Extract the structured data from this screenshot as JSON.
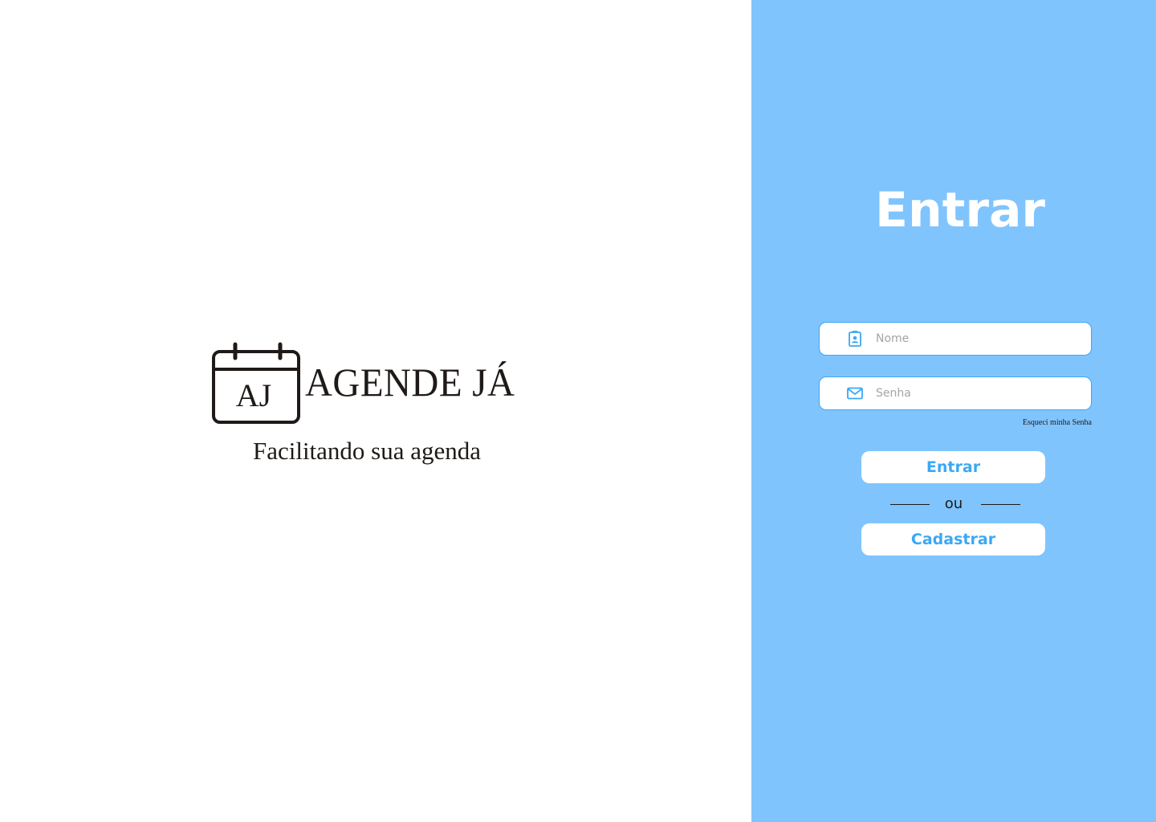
{
  "brand": {
    "logo_letters": "AJ",
    "name": "AGENDE JÁ",
    "tagline": "Facilitando sua agenda"
  },
  "login": {
    "title": "Entrar",
    "name_placeholder": "Nome",
    "name_icon": "contact-badge-icon",
    "password_placeholder": "Senha",
    "password_icon": "mail-icon",
    "forgot_password": "Esqueci minha Senha",
    "login_button": "Entrar",
    "divider_text": "ou",
    "register_button": "Cadastrar"
  },
  "colors": {
    "panel_background": "#80c4fe",
    "accent": "#3ba8f6",
    "text_dark": "#1f1a17"
  }
}
